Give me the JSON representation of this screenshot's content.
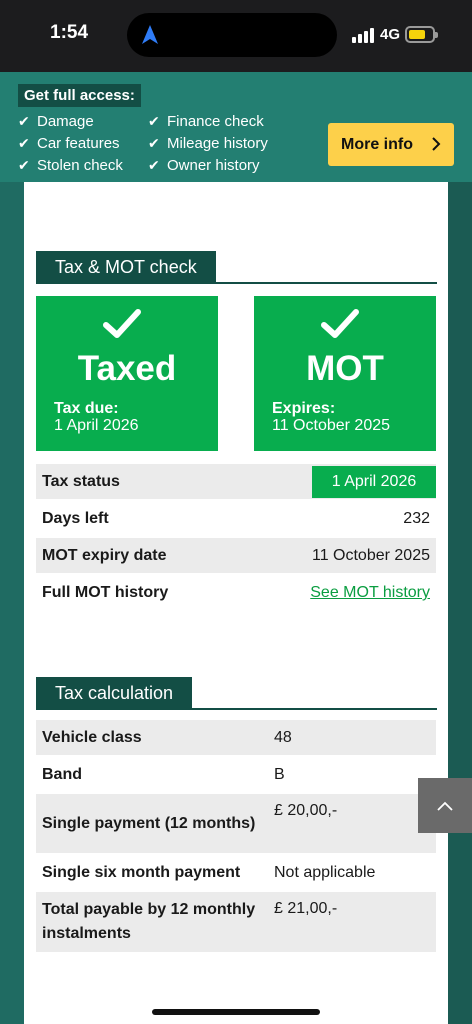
{
  "status_bar": {
    "time": "1:54",
    "network": "4G"
  },
  "promo": {
    "heading": "Get full access:",
    "features": [
      "Damage",
      "Finance check",
      "Car features",
      "Mileage history",
      "Stolen check",
      "Owner history"
    ],
    "button_label": "More info",
    "accent_color": "#fdd04a"
  },
  "tax_mot": {
    "section_title": "Tax & MOT check",
    "tax_box": {
      "title": "Taxed",
      "sub_label": "Tax due:",
      "sub_value": "1 April 2026"
    },
    "mot_box": {
      "title": "MOT",
      "sub_label": "Expires:",
      "sub_value": "11 October 2025"
    },
    "rows": [
      {
        "label": "Tax status",
        "value": "1 April 2026"
      },
      {
        "label": "Days left",
        "value": "232"
      },
      {
        "label": "MOT expiry date",
        "value": "11 October 2025"
      },
      {
        "label": "Full MOT history",
        "value": "See MOT history"
      }
    ],
    "status_color": "#08ad4e"
  },
  "tax_calc": {
    "section_title": "Tax calculation",
    "rows": [
      {
        "label": "Vehicle class",
        "value": "48"
      },
      {
        "label": "Band",
        "value": "B"
      },
      {
        "label": "Single payment (12 months)",
        "value": "£ 20,00,-"
      },
      {
        "label": "Single six month payment",
        "value": "Not applicable"
      },
      {
        "label": "Total payable by 12 monthly instalments",
        "value": "£ 21,00,-"
      }
    ]
  },
  "icons": {
    "navigation": "location-arrow-icon",
    "signal": "cellular-signal-icon",
    "battery": "battery-icon",
    "check": "check-icon",
    "chevron": "chevron-right-icon",
    "scroll_top": "chevron-up-icon"
  }
}
